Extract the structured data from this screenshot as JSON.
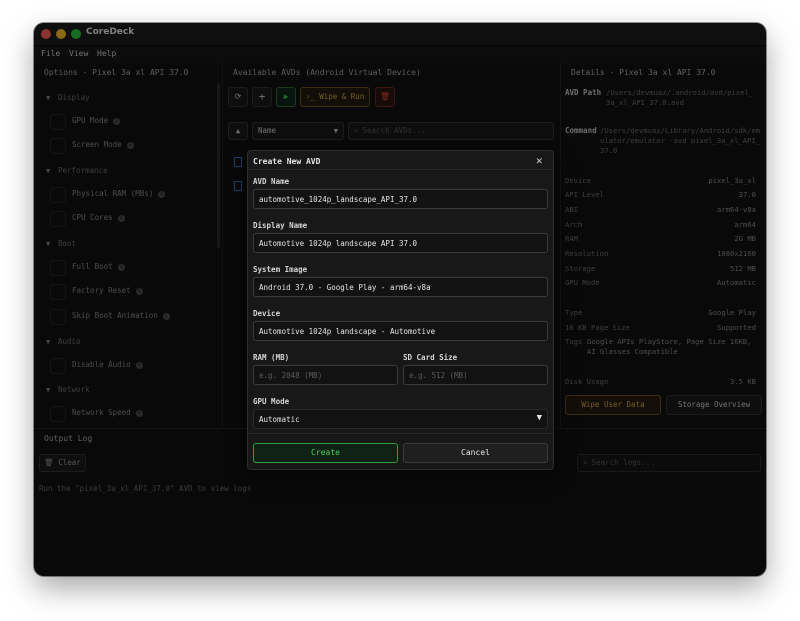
{
  "app": {
    "title": "CoreDeck"
  },
  "menu": [
    "File",
    "View",
    "Help"
  ],
  "options_panel": {
    "title": "Options - Pixel 3a xl API 37.0",
    "categories": [
      {
        "name": "Display",
        "items": [
          "GPU Mode",
          "Screen Mode"
        ]
      },
      {
        "name": "Performance",
        "items": [
          "Physical RAM (MBs)",
          "CPU Cores"
        ]
      },
      {
        "name": "Boot",
        "items": [
          "Full Boot",
          "Factory Reset",
          "Skip Boot Animation"
        ]
      },
      {
        "name": "Audio",
        "items": [
          "Disable Audio"
        ]
      },
      {
        "name": "Network",
        "items": [
          "Network Speed"
        ]
      }
    ]
  },
  "avd_panel": {
    "title": "Available AVDs (Android Virtual Device)",
    "toolbar": {
      "refresh_icon": "refresh-icon",
      "add": "+",
      "run_icon": "play-icon",
      "wipe_run": "Wipe & Run",
      "delete_icon": "trash-icon"
    },
    "sort_column": "Name",
    "search_placeholder": "Search AVDs..."
  },
  "details_panel": {
    "title": "Details - Pixel 3a xl API 37.0",
    "avd_path_label": "AVD Path",
    "avd_path": "/Users/devmuaz/.android/avd/pixel_3a_xl_API_37.0.avd",
    "command_label": "Command",
    "command": "/Users/devmuaz/Library/Android/sdk/emulator/emulator -avd pixel_3a_xl_API_37.0",
    "rows": [
      {
        "label": "Device",
        "value": "pixel_3a_xl"
      },
      {
        "label": "API Level",
        "value": "37.0"
      },
      {
        "label": "ABI",
        "value": "arm64-v8a"
      },
      {
        "label": "Arch",
        "value": "arm64"
      },
      {
        "label": "RAM",
        "value": "2G MB"
      },
      {
        "label": "Resolution",
        "value": "1080x2160"
      },
      {
        "label": "Storage",
        "value": "512 MB"
      },
      {
        "label": "GPU Mode",
        "value": "Automatic"
      }
    ],
    "rows2": [
      {
        "label": "Type",
        "value": "Google Play"
      },
      {
        "label": "16 KB Page Size",
        "value": "Supported"
      }
    ],
    "tags_label": "Tags",
    "tags_value": "Google APIs PlayStore, Page Size 16KB, AI Glasses Compatible",
    "disk_label": "Disk Usage",
    "disk_value": "3.5 KB",
    "wipe_button": "Wipe User Data",
    "storage_button": "Storage Overview"
  },
  "output": {
    "title": "Output Log",
    "clear": "Clear",
    "search_placeholder": "Search logs...",
    "message": "Run the \"pixel_3a_xl_API_37.0\" AVD to view logs"
  },
  "dialog": {
    "title": "Create New AVD",
    "avd_name_label": "AVD Name",
    "avd_name": "automotive_1024p_landscape_API_37.0",
    "display_name_label": "Display Name",
    "display_name": "Automotive 1024p landscape API 37.0",
    "system_image_label": "System Image",
    "system_image": "Android 37.0 - Google Play - arm64-v8a",
    "device_label": "Device",
    "device": "Automotive 1024p landscape - Automotive",
    "ram_label": "RAM (MB)",
    "ram_placeholder": "e.g. 2048 (MB)",
    "sd_label": "SD Card Size",
    "sd_placeholder": "e.g. 512 (MB)",
    "gpu_label": "GPU Mode",
    "gpu_value": "Automatic",
    "create": "Create",
    "cancel": "Cancel"
  },
  "colors": {
    "accent_green": "#28c840",
    "accent_yellow": "#d6a83a",
    "danger_red": "#e0473c"
  }
}
